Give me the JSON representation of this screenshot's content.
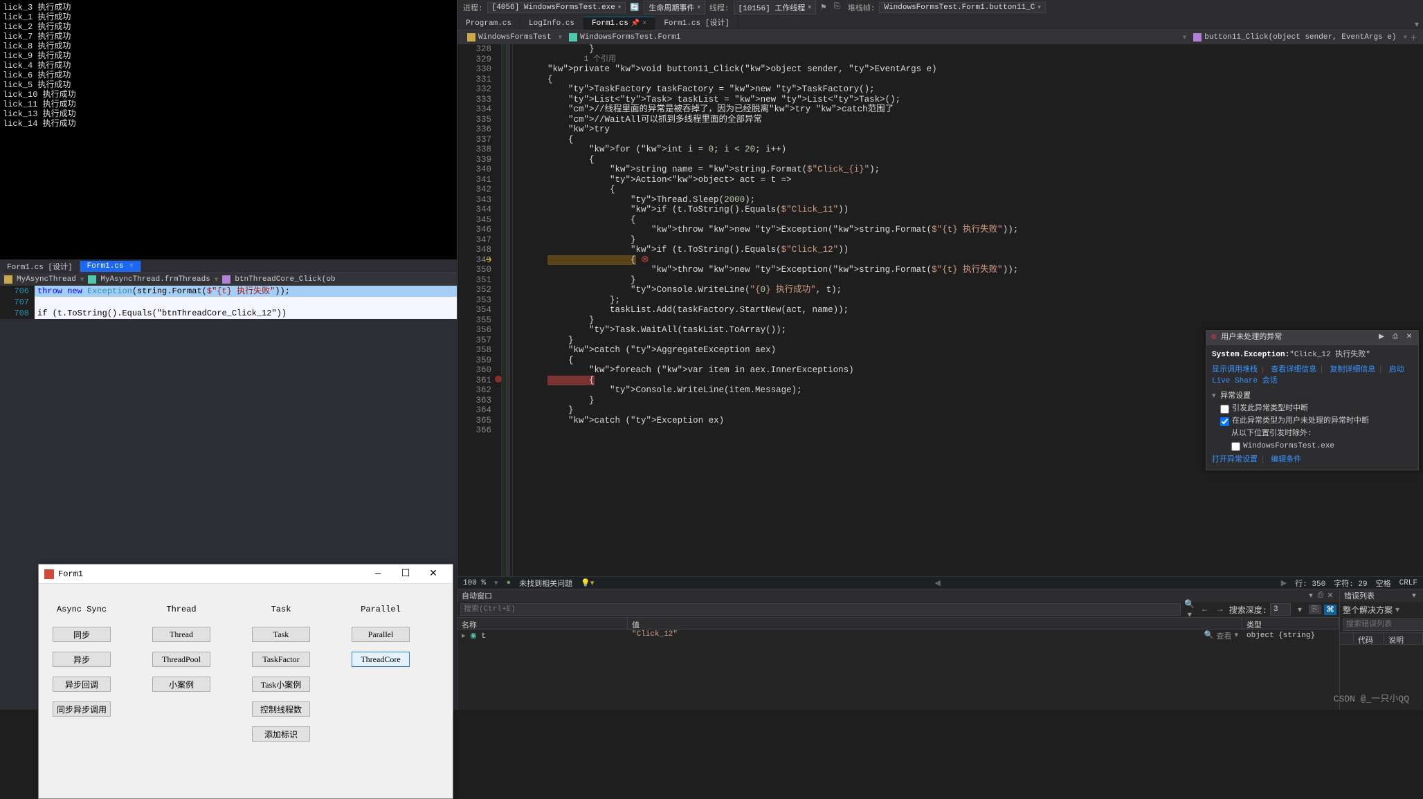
{
  "output_lines": [
    "lick_3 执行成功",
    "lick_1 执行成功",
    "lick_2 执行成功",
    "lick_7 执行成功",
    "lick_8 执行成功",
    "lick_9 执行成功",
    "lick_4 执行成功",
    "lick_6 执行成功",
    "lick_5 执行成功",
    "lick_10 执行成功",
    "lick_11 执行成功",
    "lick_13 执行成功",
    "lick_14 执行成功"
  ],
  "left_tabs": {
    "inactive": "Form1.cs [设计]",
    "active": "Form1.cs"
  },
  "left_breadcrumb": {
    "a": "MyAsyncThread",
    "b": "MyAsyncThread.frmThreads",
    "c": "btnThreadCore_Click(ob"
  },
  "gutter_lines": [
    "706",
    "707",
    "708"
  ],
  "inline_code": "throw new Exception(string.Format($\"{t} 执行失败\"));",
  "inline_code2": "if (t.ToString().Equals(\"btnThreadCore_Click_12\"))",
  "form": {
    "title": "Form1",
    "cols": [
      {
        "hdr": "Async Sync",
        "btns": [
          "同步",
          "异步",
          "异步回调",
          "同步异步调用"
        ]
      },
      {
        "hdr": "Thread",
        "btns": [
          "Thread",
          "ThreadPool",
          "小案例"
        ]
      },
      {
        "hdr": "Task",
        "btns": [
          "Task",
          "TaskFactor",
          "Task小案例",
          "控制线程数",
          "添加标识"
        ]
      },
      {
        "hdr": "Parallel",
        "btns": [
          "Parallel",
          "ThreadCore"
        ]
      }
    ],
    "focused": "ThreadCore"
  },
  "debug_bar": {
    "process_label": "进程:",
    "process": "[4056] WindowsFormsTest.exe",
    "lifecycle": "生命周期事件",
    "thread_label": "线程:",
    "thread": "[10156] 工作线程",
    "stack_label": "堆栈帧:",
    "stack": "WindowsFormsTest.Form1.button11_C"
  },
  "editor_tabs": [
    "Program.cs",
    "LogInfo.cs",
    "Form1.cs",
    "Form1.cs [设计]"
  ],
  "editor_active": "Form1.cs",
  "breadcrumb": {
    "ns": "WindowsFormsTest",
    "cls": "WindowsFormsTest.Form1",
    "mtd": "button11_Click(object sender, EventArgs e)"
  },
  "code": {
    "start": 328,
    "ref": "1 个引用",
    "lines": [
      "        }",
      "",
      "",
      "private void button11_Click(object sender, EventArgs e)",
      "{",
      "    TaskFactory taskFactory = new TaskFactory();",
      "    List<Task> taskList = new List<Task>();",
      "    //线程里面的异常是被吞掉了，因为已经脱离try catch范围了",
      "    //WaitAll可以抓到多线程里面的全部异常",
      "    try",
      "    {",
      "        for (int i = 0; i < 20; i++)",
      "        {",
      "            string name = string.Format($\"Click_{i}\");",
      "            Action<object> act = t =>",
      "            {",
      "                Thread.Sleep(2000);",
      "                if (t.ToString().Equals($\"Click_11\"))",
      "                {",
      "                    throw new Exception(string.Format($\"{t} 执行失败\"));",
      "                }",
      "                if (t.ToString().Equals($\"Click_12\"))",
      "                {",
      "                    throw new Exception(string.Format($\"{t} 执行失败\"));",
      "                }",
      "                Console.WriteLine(\"{0} 执行成功\", t);",
      "            };",
      "            taskList.Add(taskFactory.StartNew(act, name));",
      "        }",
      "        Task.WaitAll(taskList.ToArray());",
      "    }",
      "    catch (AggregateException aex)",
      "    {",
      "        foreach (var item in aex.InnerExceptions)",
      "        {",
      "            Console.WriteLine(item.Message);",
      "        }",
      "    }",
      "    catch (Exception ex)"
    ],
    "highlight_line": 350,
    "breakpoint_line": 362,
    "error_line": 362
  },
  "exception": {
    "title": "用户未处理的异常",
    "type": "System.Exception:",
    "msg": "\"Click_12 执行失败\"",
    "links": [
      "显示调用堆栈",
      "查看详细信息",
      "复制详细信息",
      "启动 Live Share 会话"
    ],
    "settings_header": "异常设置",
    "chk1": "引发此异常类型时中断",
    "chk2": "在此异常类型为用户未处理的异常时中断",
    "sub": "从以下位置引发时除外:",
    "subitem": "WindowsFormsTest.exe",
    "links2": [
      "打开异常设置",
      "编辑条件"
    ]
  },
  "status": {
    "zoom": "100 %",
    "issues": "未找到相关问题",
    "line": "行: 350",
    "col": "字符: 29",
    "sel": "空格",
    "crlf": "CRLF"
  },
  "auto_panel": {
    "title": "自动窗口",
    "search_ph": "搜索(Ctrl+E)",
    "depth_label": "搜索深度:",
    "depth": "3",
    "cols": [
      "名称",
      "值",
      "类型"
    ],
    "row": {
      "name": "t",
      "val": "\"Click_12\"",
      "type": "object {string}",
      "lookup": "查看"
    }
  },
  "err_panel": {
    "title": "错误列表",
    "scope": "整个解决方案",
    "search_ph": "搜索错误列表",
    "cols": [
      "代码",
      "说明"
    ]
  },
  "watermark": "CSDN @_一只小QQ"
}
